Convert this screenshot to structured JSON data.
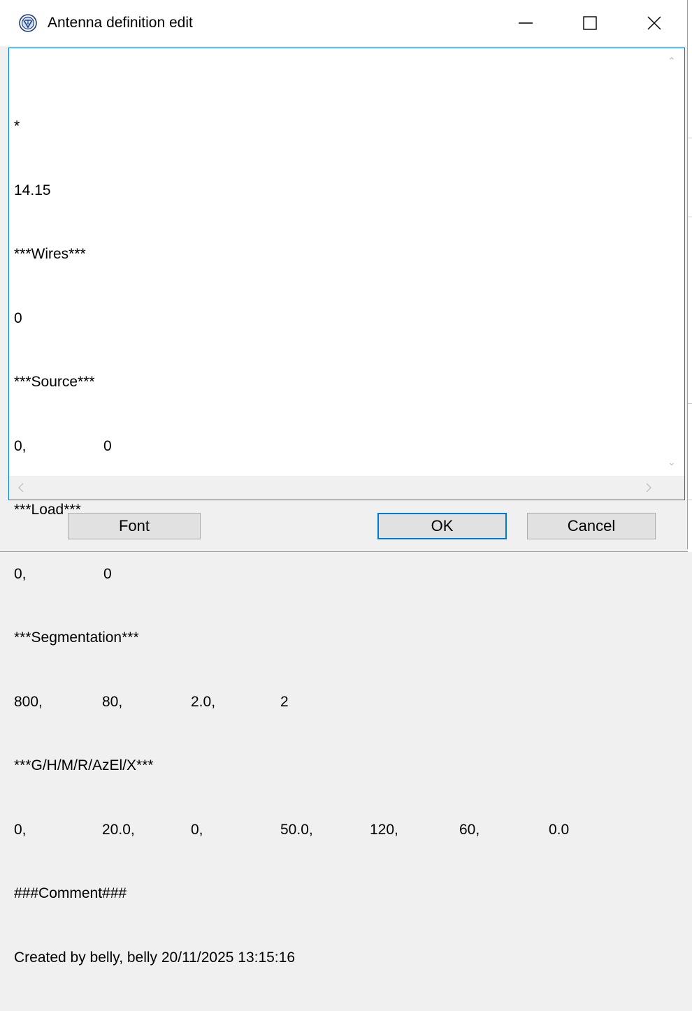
{
  "window": {
    "title": "Antenna definition edit",
    "controls": {
      "minimize": "minimize-icon",
      "maximize": "maximize-icon",
      "close": "close-icon"
    }
  },
  "editor": {
    "lines": [
      {
        "cells": [
          "*"
        ]
      },
      {
        "cells": [
          "14.15"
        ]
      },
      {
        "cells": [
          "***Wires***"
        ]
      },
      {
        "cells": [
          "0"
        ]
      },
      {
        "cells": [
          "***Source***"
        ]
      },
      {
        "cells": [
          "0,",
          "0"
        ]
      },
      {
        "cells": [
          "***Load***"
        ]
      },
      {
        "cells": [
          "0,",
          "0"
        ]
      },
      {
        "cells": [
          "***Segmentation***"
        ]
      },
      {
        "cells": [
          "800,",
          "80,",
          "2.0,",
          "2"
        ]
      },
      {
        "cells": [
          "***G/H/M/R/AzEl/X***"
        ]
      },
      {
        "cells": [
          "0,",
          "20.0,",
          "0,",
          "50.0,",
          "120,",
          "60,",
          "0.0"
        ]
      },
      {
        "cells": [
          "###Comment###"
        ]
      },
      {
        "cells": [
          "Created by belly, belly 20/11/2025 13:15:16"
        ]
      }
    ]
  },
  "buttons": {
    "font_label": "Font",
    "ok_label": "OK",
    "cancel_label": "Cancel"
  },
  "colors": {
    "accent": "#0078d7",
    "button_bg": "#e1e1e1",
    "dialog_bg": "#f0f0f0"
  }
}
